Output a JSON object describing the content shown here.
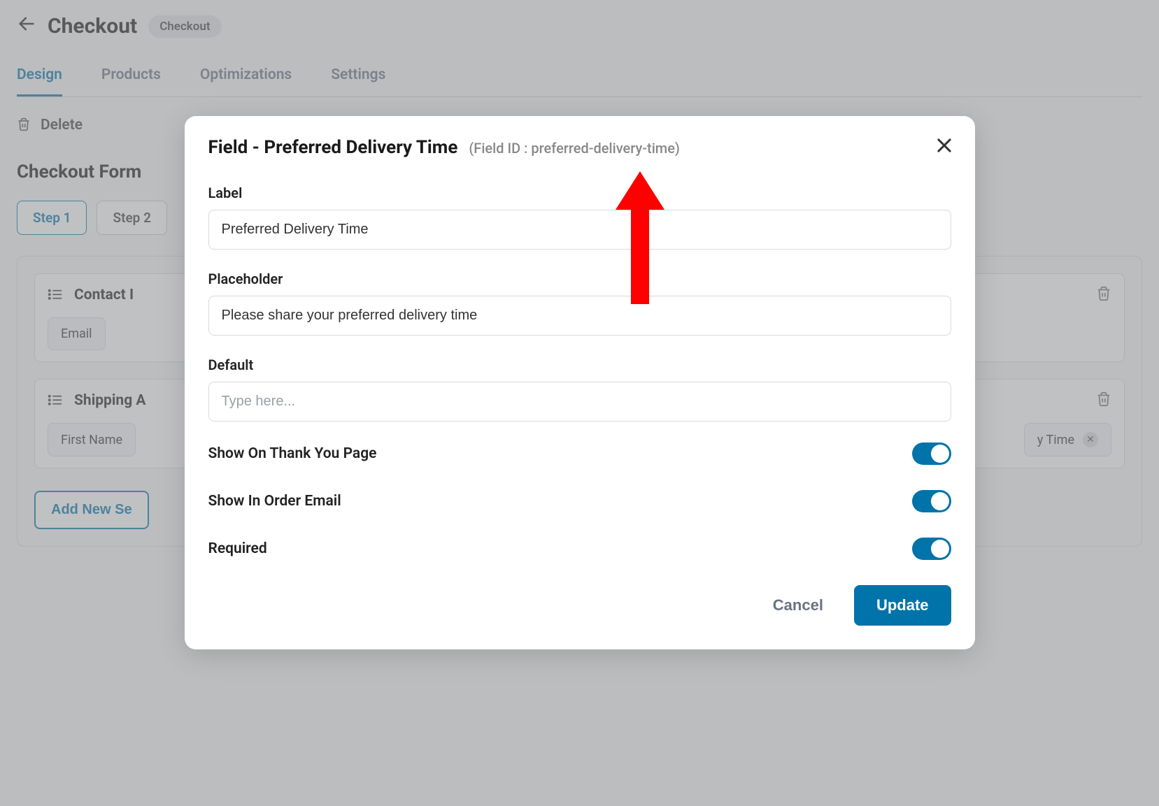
{
  "header": {
    "title": "Checkout",
    "badge": "Checkout"
  },
  "tabs": [
    {
      "label": "Design",
      "active": true
    },
    {
      "label": "Products",
      "active": false
    },
    {
      "label": "Optimizations",
      "active": false
    },
    {
      "label": "Settings",
      "active": false
    }
  ],
  "delete_label": "Delete",
  "section_heading": "Checkout Form",
  "steps": [
    {
      "label": "Step 1",
      "active": true
    },
    {
      "label": "Step 2",
      "active": false
    }
  ],
  "sections": [
    {
      "title": "Contact I",
      "fields": [
        {
          "label": "Email",
          "removable": false
        }
      ]
    },
    {
      "title": "Shipping A",
      "fields": [
        {
          "label": "First Name",
          "removable": false
        },
        {
          "label": "y Time",
          "removable": true
        }
      ]
    }
  ],
  "add_section_label": "Add New Se",
  "modal": {
    "title_prefix": "Field - ",
    "title_name": "Preferred Delivery Time",
    "field_id_label": "(Field ID : preferred-delivery-time)",
    "labels": {
      "label": "Label",
      "placeholder": "Placeholder",
      "default": "Default",
      "show_thank_you": "Show On Thank You Page",
      "show_email": "Show In Order Email",
      "required": "Required"
    },
    "values": {
      "label": "Preferred Delivery Time",
      "placeholder": "Please share your preferred delivery time",
      "default": "",
      "default_placeholder": "Type here...",
      "show_thank_you": true,
      "show_email": true,
      "required": true
    },
    "buttons": {
      "cancel": "Cancel",
      "update": "Update"
    }
  }
}
